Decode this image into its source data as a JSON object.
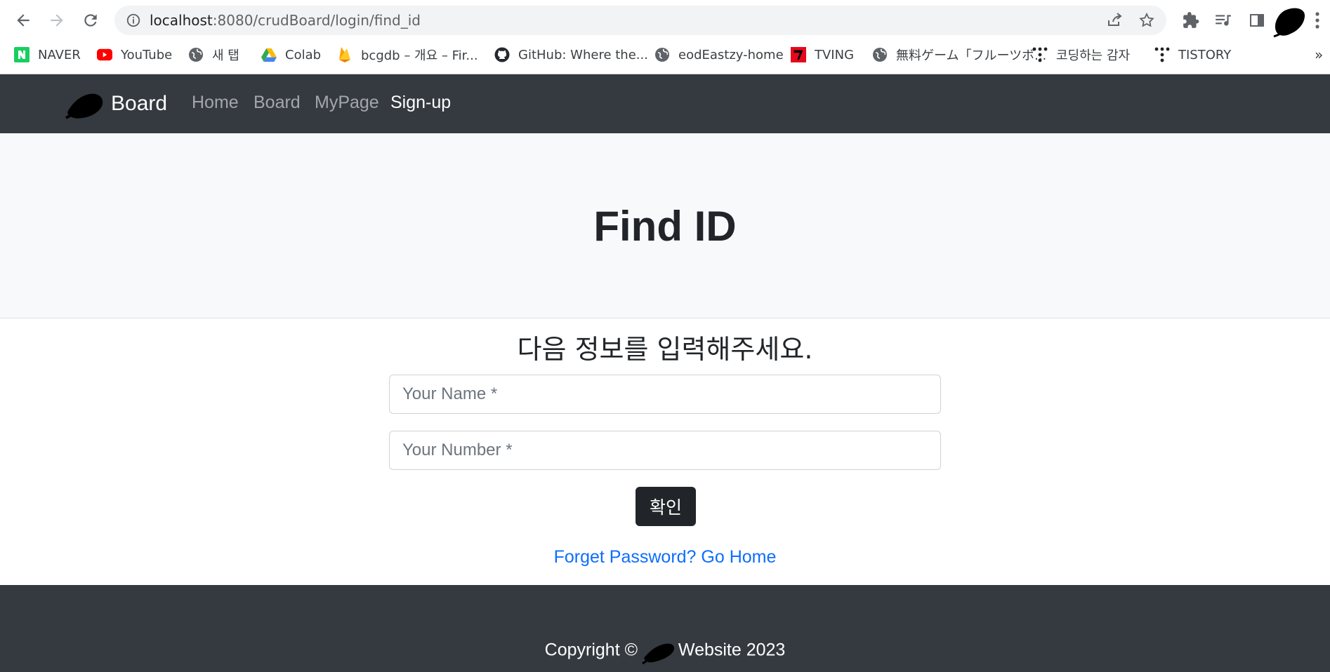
{
  "browser": {
    "url_host": "localhost",
    "url_path": ":8080/crudBoard/login/find_id",
    "bookmarks": [
      {
        "label": "NAVER",
        "icon": "naver-icon"
      },
      {
        "label": "YouTube",
        "icon": "youtube-icon"
      },
      {
        "label": "새 탭",
        "icon": "globe-icon"
      },
      {
        "label": "Colab",
        "icon": "drive-icon"
      },
      {
        "label": "bcgdb – 개요 – Fir...",
        "icon": "firebase-icon"
      },
      {
        "label": "GitHub: Where the...",
        "icon": "github-icon"
      },
      {
        "label": "eodEastzy-home",
        "icon": "globe-icon"
      },
      {
        "label": "TVING",
        "icon": "tving-icon"
      },
      {
        "label": "無料ゲーム「フルーツボ...",
        "icon": "globe-icon"
      },
      {
        "label": "코딩하는 감자",
        "icon": "tistory-icon"
      },
      {
        "label": "TISTORY",
        "icon": "tistory-icon"
      }
    ],
    "more_label": "»"
  },
  "navbar": {
    "brand": "Board",
    "links": [
      "Home",
      "Board",
      "MyPage",
      "Sign-up"
    ]
  },
  "header": {
    "title": "Find ID"
  },
  "form": {
    "subtitle": "다음 정보를 입력해주세요.",
    "name_placeholder": "Your Name *",
    "number_placeholder": "Your Number *",
    "submit_label": "확인",
    "link_label": "Forget Password? Go Home"
  },
  "footer": {
    "copyright_prefix": "Copyright ©",
    "copyright_suffix": "Website 2023"
  },
  "colors": {
    "navbar_bg": "#343a40",
    "header_bg": "#f8f9fa",
    "link": "#0d6efd",
    "button_bg": "#212529"
  }
}
